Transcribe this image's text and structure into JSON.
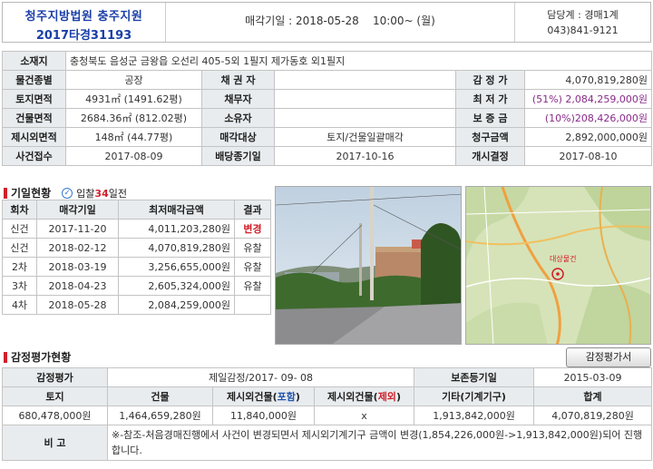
{
  "header": {
    "court": "청주지방법원 충주지원",
    "case_no": "2017타경31193",
    "sale_date_label": "매각기일 : 2018-05-28",
    "sale_time": "10:00~ (월)",
    "dept": "담당계 : 경매1계",
    "phone": "043)841-9121"
  },
  "info": {
    "address_label": "소재지",
    "address": "충청북도 음성군 금왕읍 오선리 405-5외 1필지 제가동호 외1필지",
    "rows": [
      {
        "l1": "물건종별",
        "v1": "공장",
        "l2": "채 권 자",
        "v2": "",
        "l3": "감 정 가",
        "v3": "4,070,819,280원"
      },
      {
        "l1": "토지면적",
        "v1": "4931㎡ (1491.62평)",
        "l2": "채무자",
        "v2": "",
        "l3": "최 저 가",
        "v3": "(51%) 2,084,259,000원"
      },
      {
        "l1": "건물면적",
        "v1": "2684.36㎡ (812.02평)",
        "l2": "소유자",
        "v2": "",
        "l3": "보 증 금",
        "v3": "(10%)208,426,000원"
      },
      {
        "l1": "제시외면적",
        "v1": "148㎡ (44.77평)",
        "l2": "매각대상",
        "v2": "토지/건물일괄매각",
        "l3": "청구금액",
        "v3": "2,892,000,000원"
      },
      {
        "l1": "사건접수",
        "v1": "2017-08-09",
        "l2": "배당종기일",
        "v2": "2017-10-16",
        "l3": "개시결정",
        "v3": "2017-08-10"
      }
    ]
  },
  "history": {
    "title": "기일현황",
    "sub_prefix": "입찰",
    "sub_days": "34",
    "sub_suffix": "일전",
    "columns": [
      "회차",
      "매각기일",
      "최저매각금액",
      "결과"
    ],
    "rows": [
      {
        "round": "신건",
        "date": "2017-11-20",
        "amount": "4,011,203,280원",
        "result": "변경"
      },
      {
        "round": "신건",
        "date": "2018-02-12",
        "amount": "4,070,819,280원",
        "result": "유찰"
      },
      {
        "round": "2차",
        "date": "2018-03-19",
        "amount": "3,256,655,000원",
        "result": "유찰"
      },
      {
        "round": "3차",
        "date": "2018-04-23",
        "amount": "2,605,324,000원",
        "result": "유찰"
      },
      {
        "round": "4차",
        "date": "2018-05-28",
        "amount": "2,084,259,000원",
        "result": ""
      }
    ]
  },
  "map_label": "대상물건",
  "appraisal": {
    "title": "감정평가현황",
    "button": "감정평가서",
    "org_label": "감정평가",
    "org_value": "제일감정/2017- 09- 08",
    "pres_label": "보존등기일",
    "pres_value": "2015-03-09",
    "headers": [
      "토지",
      "건물",
      "제시외건물(",
      "포함",
      ")",
      "제시외건물(",
      "제외",
      ")",
      "기타(기계기구)",
      "합계"
    ],
    "values": [
      "680,478,000원",
      "1,464,659,280원",
      "11,840,000원",
      "x",
      "1,913,842,000원",
      "4,070,819,280원"
    ],
    "note_label": "비 고",
    "note": "※-참조-처음경매진행에서 사건이 변경되면서 제시외기계기구 금액이 변경(1,854,226,000원->1,913,842,000원)되어 진행합니다."
  }
}
